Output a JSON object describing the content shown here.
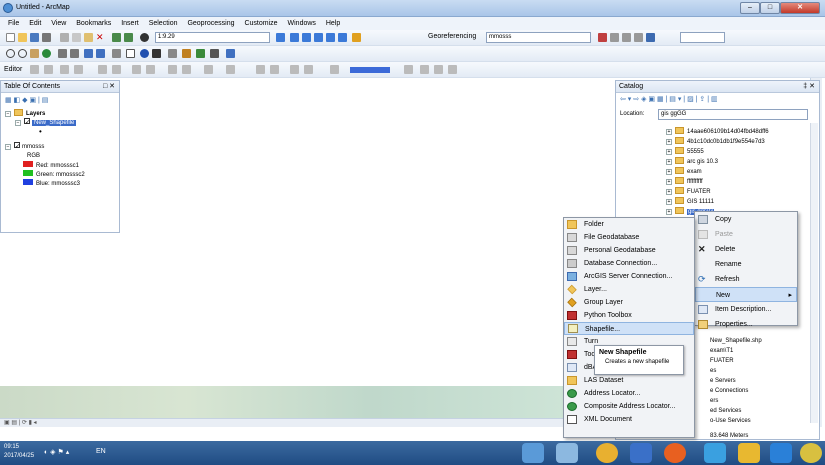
{
  "window": {
    "title": "Untitled - ArcMap"
  },
  "menu": [
    "File",
    "Edit",
    "View",
    "Bookmarks",
    "Insert",
    "Selection",
    "Geoprocessing",
    "Customize",
    "Windows",
    "Help"
  ],
  "toolbar": {
    "scale": "1:9.29",
    "georef_label": "Georeferencing",
    "georef_layer": "mmosss",
    "editor_label": "Editor"
  },
  "toc": {
    "title": "Table Of Contents",
    "layers_label": "Layers",
    "shapefile_layer": "New_Shapefile",
    "raster_layer": "mmosss",
    "rgb_label": "RGB",
    "bands": [
      {
        "label": "Red:   mmosssc1",
        "color": "#e02020"
      },
      {
        "label": "Green: mmosssc2",
        "color": "#20c020"
      },
      {
        "label": "Blue:  mmosssc3",
        "color": "#2040e0"
      }
    ]
  },
  "catalog": {
    "title": "Catalog",
    "location_label": "Location:",
    "location_value": "gis ggGG",
    "items": [
      "14aae606109b14d04fbd48dff6",
      "4b1c10dc0b1db1f9e554e7d3",
      "55555",
      "arc gis 10.3",
      "exam",
      "ffffffffff",
      "FUATER",
      "GIS 11111",
      "gis ggGG"
    ],
    "below": [
      "New_Shapefile.shp",
      "exam\\T1",
      "FUATER",
      "es",
      "e Servers",
      "e Connections",
      "ers",
      "ed Services",
      "o-Use Services"
    ],
    "status": "83.648 Meters"
  },
  "context_menu": {
    "items": [
      "Copy",
      "Paste",
      "Delete",
      "Rename",
      "Refresh",
      "New",
      "Item Description...",
      "Properties..."
    ]
  },
  "new_submenu": {
    "items": [
      "Folder",
      "File Geodatabase",
      "Personal Geodatabase",
      "Database Connection...",
      "ArcGIS Server Connection...",
      "Layer...",
      "Group Layer",
      "Python Toolbox",
      "Shapefile...",
      "Turn",
      "Tool",
      "dBAS",
      "LAS Dataset",
      "Address Locator...",
      "Composite Address Locator...",
      "XML Document"
    ]
  },
  "tooltip": {
    "title": "New Shapefile",
    "text": "Creates a new shapefile"
  },
  "taskbar": {
    "time": "09:15",
    "date": "2017/04/25",
    "lang": "EN"
  }
}
